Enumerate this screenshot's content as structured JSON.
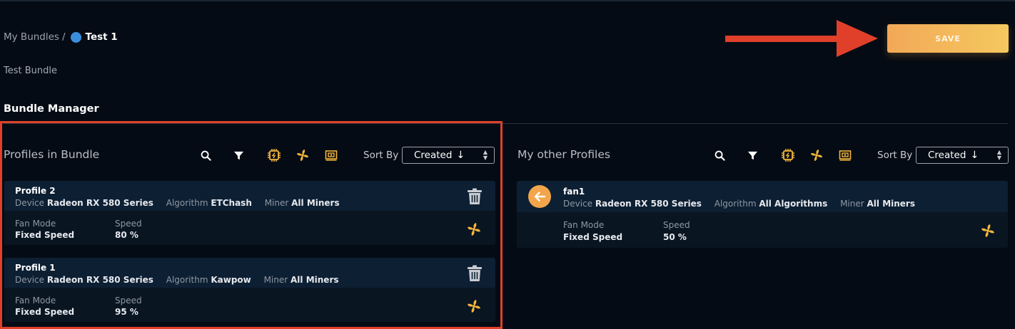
{
  "breadcrumb": {
    "root": "My Bundles",
    "separator": "/",
    "current": "Test 1"
  },
  "bundle_description": "Test Bundle",
  "save_label": "SAVE",
  "section_title": "Bundle Manager",
  "colors": {
    "accent": "#f2a857",
    "highlight": "#e0402a",
    "dot": "#3a8fdd",
    "background": "#050b14"
  },
  "left_panel": {
    "title": "Profiles in Bundle",
    "sort_label": "Sort By",
    "sort_value": "Created",
    "icons": [
      "search-icon",
      "filter-icon",
      "cpu-icon",
      "fan-icon",
      "gpu-icon"
    ],
    "profiles": [
      {
        "name": "Profile 2",
        "device_label": "Device",
        "device": "Radeon RX 580 Series",
        "algorithm_label": "Algorithm",
        "algorithm": "ETChash",
        "miner_label": "Miner",
        "miner": "All Miners",
        "fan_mode_label": "Fan Mode",
        "fan_mode": "Fixed Speed",
        "speed_label": "Speed",
        "speed": "80 %"
      },
      {
        "name": "Profile 1",
        "device_label": "Device",
        "device": "Radeon RX 580 Series",
        "algorithm_label": "Algorithm",
        "algorithm": "Kawpow",
        "miner_label": "Miner",
        "miner": "All Miners",
        "fan_mode_label": "Fan Mode",
        "fan_mode": "Fixed Speed",
        "speed_label": "Speed",
        "speed": "95 %"
      }
    ]
  },
  "right_panel": {
    "title": "My other Profiles",
    "sort_label": "Sort By",
    "sort_value": "Created",
    "icons": [
      "search-icon",
      "filter-icon",
      "cpu-icon",
      "fan-icon",
      "gpu-icon"
    ],
    "profiles": [
      {
        "name": "fan1",
        "device_label": "Device",
        "device": "Radeon RX 580 Series",
        "algorithm_label": "Algorithm",
        "algorithm": "All Algorithms",
        "miner_label": "Miner",
        "miner": "All Miners",
        "fan_mode_label": "Fan Mode",
        "fan_mode": "Fixed Speed",
        "speed_label": "Speed",
        "speed": "50 %"
      }
    ]
  }
}
